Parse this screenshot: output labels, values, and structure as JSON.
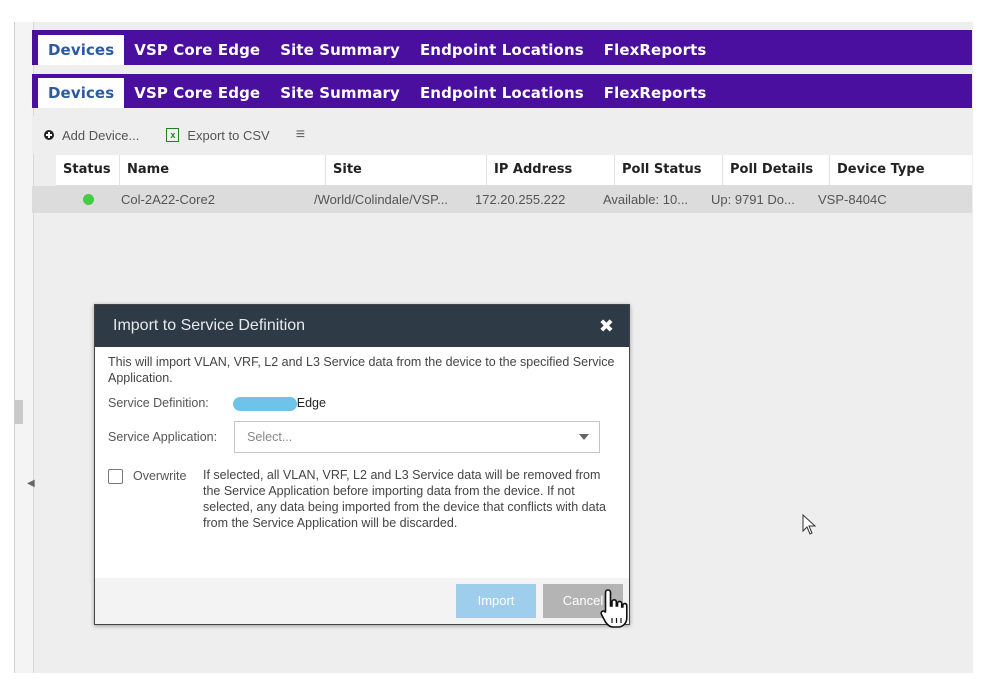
{
  "tabs": [
    "Devices",
    "VSP Core Edge",
    "Site Summary",
    "Endpoint Locations",
    "FlexReports"
  ],
  "toolbar": {
    "add_device": "Add Device...",
    "export_csv": "Export to CSV"
  },
  "grid": {
    "headers": [
      "Status",
      "Name",
      "Site",
      "IP Address",
      "Poll Status",
      "Poll Details",
      "Device Type"
    ],
    "rows": [
      {
        "status": "green",
        "name": "Col-2A22-Core2",
        "site": "/World/Colindale/VSP...",
        "ip": "172.20.255.222",
        "poll_status": "Available: 10...",
        "poll_details": "Up: 9791 Do...",
        "device_type": "VSP-8404C"
      }
    ]
  },
  "dialog": {
    "title": "Import to Service Definition",
    "intro": "This will import VLAN, VRF, L2 and L3 Service data from the device to the specified Service Application.",
    "service_definition_label": "Service Definition:",
    "service_definition_value": "Edge",
    "service_application_label": "Service Application:",
    "service_application_placeholder": "Select...",
    "overwrite_label": "Overwrite",
    "overwrite_description": "If selected, all VLAN, VRF, L2 and L3 Service data will be removed from the Service Application before importing data from the device. If not selected, any data being imported from the device that conflicts with data from the Service Application will be discarded.",
    "import_button": "Import",
    "cancel_button": "Cancel"
  },
  "colors": {
    "tabbar": "#4a0f9e",
    "active_tab_text": "#2c5aa0",
    "dialog_header": "#2f3a47",
    "import_button": "#9fcdec",
    "status_ok": "#44cc44"
  },
  "icons": [
    "add-icon",
    "excel-icon",
    "menu-icon",
    "close-icon",
    "chevron-down-icon",
    "pointer-cursor-icon",
    "hand-cursor-icon"
  ]
}
